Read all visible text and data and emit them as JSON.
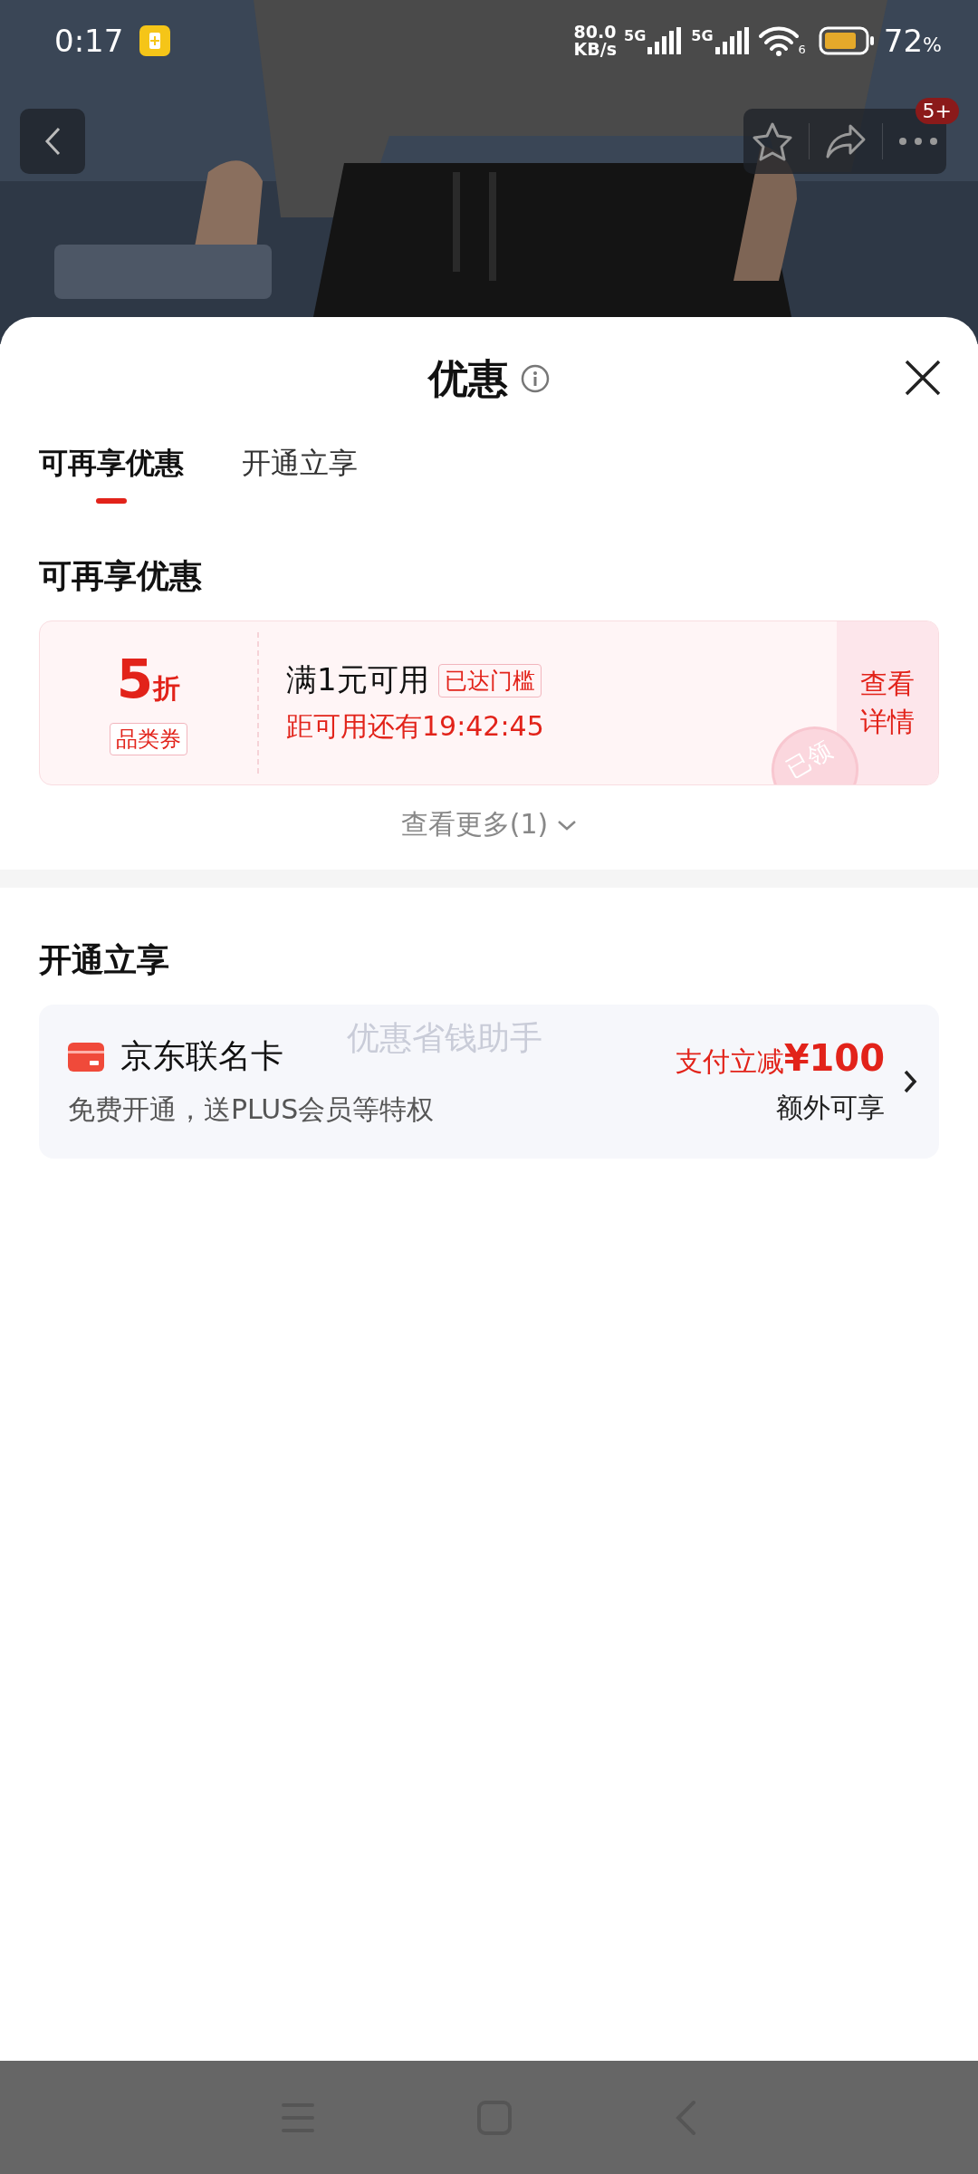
{
  "status_bar": {
    "time": "0:17",
    "net_speed": [
      "80.0",
      "KB/s"
    ],
    "signal_labels": [
      "5G",
      "5G"
    ],
    "wifi_label": "6",
    "battery": "72",
    "battery_unit": "%"
  },
  "header": {
    "badge": "5+"
  },
  "sheet": {
    "title": "优惠",
    "tabs": [
      {
        "label": "可再享优惠",
        "selected": true
      },
      {
        "label": "开通立享",
        "selected": false
      }
    ],
    "sections": [
      {
        "kind": "coupons",
        "title": "可再享优惠",
        "coupons": [
          {
            "amount": "5",
            "unit": "折",
            "type": "品类券",
            "condition": "满1元可用",
            "tag": "已达门槛",
            "countdown": "距可用还有19:42:45",
            "stamp": "已领",
            "action": "查看详情"
          }
        ],
        "more": "查看更多(1)"
      },
      {
        "kind": "offers",
        "title": "开通立享",
        "offers": [
          {
            "name": "京东联名卡",
            "desc": "免费开通，送PLUS会员等特权",
            "benefit": "支付立减**¥100**",
            "note": "额外可享"
          }
        ]
      }
    ]
  },
  "overlay_text": "优惠省钱助手"
}
